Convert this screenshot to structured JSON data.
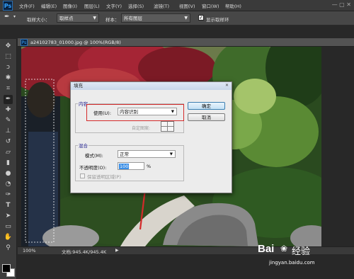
{
  "app": {
    "logo": "Ps"
  },
  "menubar": {
    "items": [
      "文件(F)",
      "编辑(E)",
      "图像(I)",
      "图层(L)",
      "文字(Y)",
      "选择(S)",
      "滤镜(T)",
      "视图(V)",
      "窗口(W)",
      "帮助(H)"
    ],
    "window_controls": "— ▢ ✕"
  },
  "options": {
    "sample_size_label": "取样大小：",
    "sample_size_value": "取样点",
    "sample_label": "样本：",
    "sample_value": "所有图层",
    "show_ring_label": "显示取样环",
    "show_ring_checked": true
  },
  "document": {
    "tab_title": "a24102783_01000.jpg @ 100%(RGB/8)",
    "zoom": "100%",
    "doc_info": "文档:945.4K/945.4K"
  },
  "dialog": {
    "title": "填充",
    "contents_group": "内容",
    "use_label": "使用(U):",
    "use_value": "内容识别",
    "custom_pattern_label": "自定图案:",
    "blending_group": "混合",
    "mode_label": "模式(M):",
    "mode_value": "正常",
    "opacity_label": "不透明度(O):",
    "opacity_value": "100",
    "opacity_unit": "%",
    "preserve_label": "保留透明区域(P)",
    "ok_label": "确定",
    "cancel_label": "取消"
  },
  "watermark": {
    "brand": "Bai",
    "brand_cn": "经验",
    "url": "jingyan.baidu.com"
  },
  "colors": {
    "accent": "#1d7ec9",
    "highlight_box": "#d42a2a"
  }
}
